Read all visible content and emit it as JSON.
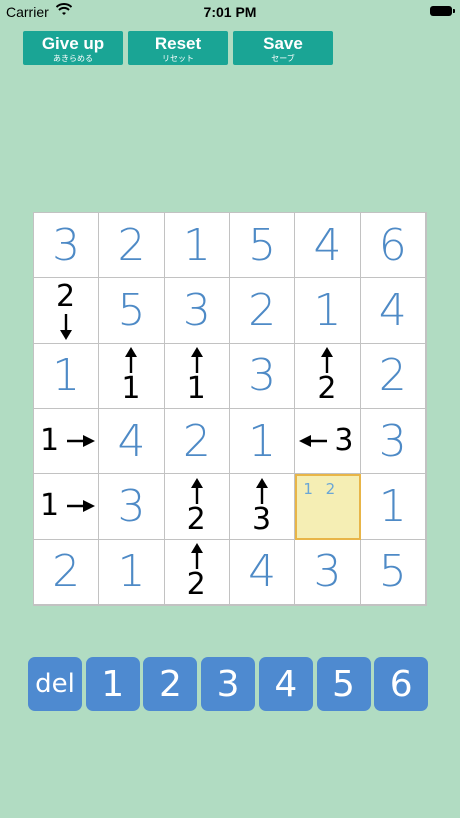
{
  "status": {
    "carrier": "Carrier",
    "time": "7:01 PM"
  },
  "toolbar": [
    {
      "label": "Give up",
      "sub": "あきらめる"
    },
    {
      "label": "Reset",
      "sub": "リセット"
    },
    {
      "label": "Save",
      "sub": "セーブ"
    }
  ],
  "board": {
    "cells": [
      [
        "3",
        "2",
        "1",
        "5",
        "4",
        "6"
      ],
      [
        "clue:2:down",
        "5",
        "3",
        "2",
        "1",
        "4"
      ],
      [
        "1",
        "clue:1:up",
        "clue:1:up",
        "3",
        "clue:2:up",
        "2"
      ],
      [
        "clue:1:right",
        "4",
        "2",
        "1",
        "clue:3:left",
        "3"
      ],
      [
        "clue:1:right",
        "3",
        "clue:2:up",
        "clue:3:up",
        "memo:1 2",
        "1"
      ],
      [
        "2",
        "1",
        "clue:2:up",
        "4",
        "3",
        "5"
      ]
    ],
    "selected": {
      "row": 4,
      "col": 4
    },
    "colors": {
      "value": "#4e8ac6",
      "memo": "#6aa6d6",
      "selected_bg": "#f5eeb4",
      "selected_border": "#e8b548"
    }
  },
  "keypad": [
    "del",
    "1",
    "2",
    "3",
    "4",
    "5",
    "6"
  ],
  "colors": {
    "background": "#b1dcc2",
    "toolbar_button": "#1aa595",
    "keypad_button": "#4e8ad0"
  }
}
